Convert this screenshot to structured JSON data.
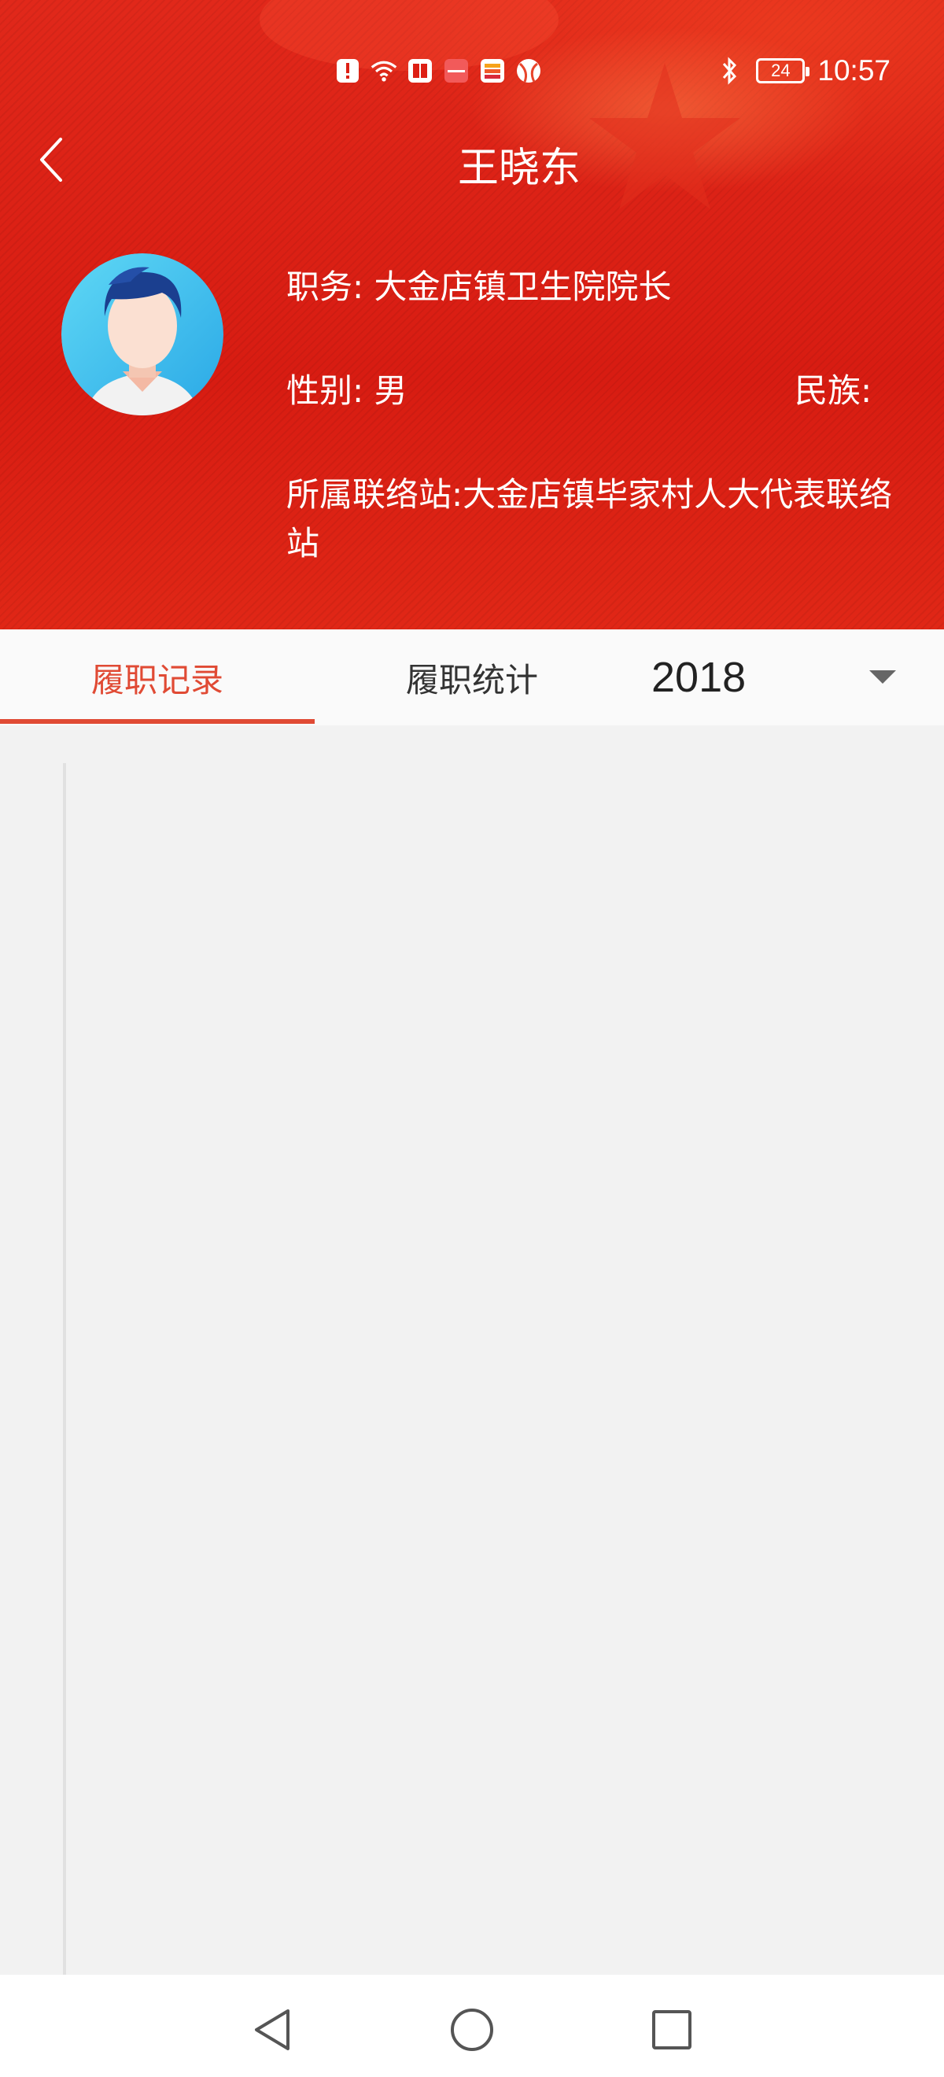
{
  "status_bar": {
    "time": "10:57",
    "battery": "24",
    "left_icons": [
      "alert-icon",
      "wifi-icon",
      "book-app-icon",
      "huawei-app-icon",
      "stack-app-icon",
      "ball-app-icon"
    ],
    "right_icons": [
      "bluetooth-icon",
      "battery-icon"
    ]
  },
  "header": {
    "title": "王晓东",
    "back_icon": "chevron-left-icon"
  },
  "profile": {
    "duty_label": "职务:",
    "duty_value": "大金店镇卫生院院长",
    "gender_label": "性别:",
    "gender_value": "男",
    "ethnicity_label": "民族:",
    "ethnicity_value": "",
    "station_label": "所属联络站:",
    "station_value": "大金店镇毕家村人大代表联络站"
  },
  "tabs": [
    {
      "label": "履职记录",
      "active": true
    },
    {
      "label": "履职统计",
      "active": false
    }
  ],
  "year_select": {
    "value": "2018"
  },
  "nav_bar": {
    "buttons": [
      "back-triangle-icon",
      "home-circle-icon",
      "recent-square-icon"
    ]
  },
  "colors": {
    "header_red": "#dd1f14",
    "accent": "#e04a34",
    "content_bg": "#f2f2f2"
  }
}
